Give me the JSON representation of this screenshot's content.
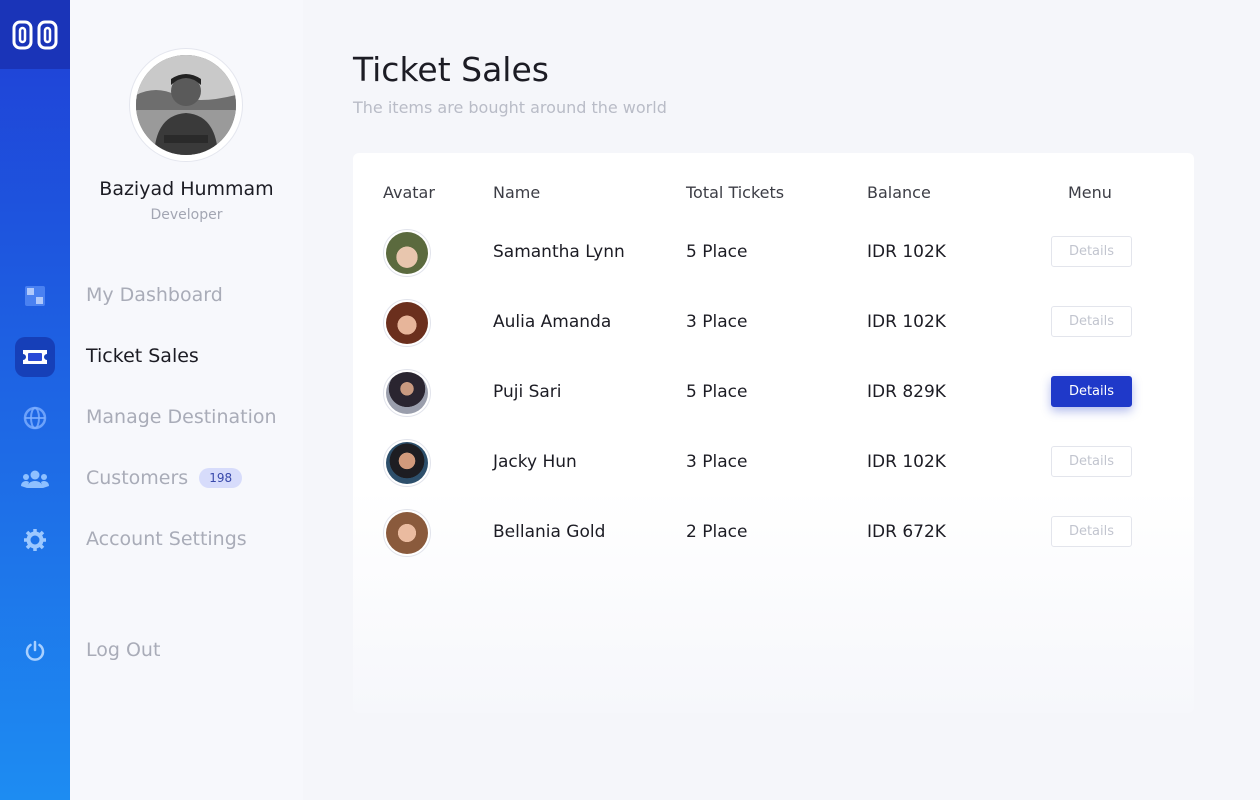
{
  "profile": {
    "name": "Baziyad Hummam",
    "role": "Developer"
  },
  "nav": {
    "dashboard": "My Dashboard",
    "tickets": "Ticket Sales",
    "destination": "Manage Destination",
    "customers": "Customers",
    "customers_badge": "198",
    "settings": "Account Settings",
    "logout": "Log Out"
  },
  "page": {
    "title": "Ticket Sales",
    "subtitle": "The items are bought around the world"
  },
  "table": {
    "headers": {
      "avatar": "Avatar",
      "name": "Name",
      "tickets": "Total Tickets",
      "balance": "Balance",
      "menu": "Menu"
    },
    "rows": [
      {
        "name": "Samantha Lynn",
        "tickets": "5 Place",
        "balance": "IDR 102K",
        "action": "Details"
      },
      {
        "name": "Aulia Amanda",
        "tickets": "3 Place",
        "balance": "IDR 102K",
        "action": "Details"
      },
      {
        "name": "Puji Sari",
        "tickets": "5 Place",
        "balance": "IDR 829K",
        "action": "Details"
      },
      {
        "name": "Jacky Hun",
        "tickets": "3 Place",
        "balance": "IDR 102K",
        "action": "Details"
      },
      {
        "name": "Bellania Gold",
        "tickets": "2 Place",
        "balance": "IDR 672K",
        "action": "Details"
      }
    ]
  },
  "colors": {
    "accent": "#1f39c9",
    "rail_top": "#1f3fd6",
    "rail_bottom": "#1d8cf2",
    "badge_bg": "#d7dcfb"
  },
  "icons": {
    "logo": "logo-icon",
    "dashboard": "dashboard-grid-icon",
    "tickets": "ticket-icon",
    "destination": "globe-icon",
    "customers": "users-icon",
    "settings": "gear-icon",
    "logout": "power-icon"
  }
}
